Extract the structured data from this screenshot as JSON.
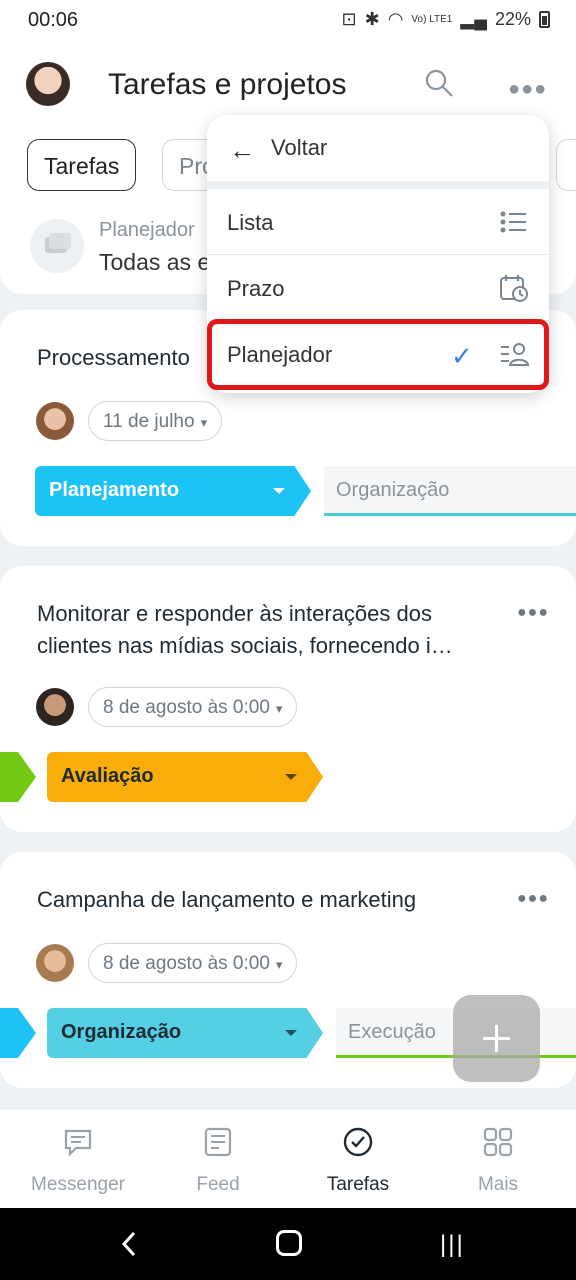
{
  "status_bar": {
    "time": "00:06",
    "network": "Vo) LTE1",
    "battery": "22%"
  },
  "header": {
    "title": "Tarefas e projetos",
    "tabs": [
      {
        "label": "Tarefas"
      },
      {
        "label": "Projetos"
      }
    ],
    "view_caption": "Planejador",
    "view_value": "Todas as etapas"
  },
  "menu": {
    "back_label": "Voltar",
    "items": [
      {
        "label": "Lista",
        "icon": "list-icon"
      },
      {
        "label": "Prazo",
        "icon": "calendar-clock-icon"
      },
      {
        "label": "Planejador",
        "icon": "planner-user-icon",
        "selected": true
      }
    ]
  },
  "cards": [
    {
      "title": "Processamento",
      "date": "11 de julho",
      "stage": "Planejamento",
      "stage_color": "#1ec3f5",
      "next_stage": "Organização",
      "next_stage_color": "#4dc9dc"
    },
    {
      "title": "Monitorar e responder às interações dos clientes nas mídias sociais, fornecendo i…",
      "date": "8 de agosto às 0:00",
      "stage": "Avaliação",
      "stage_color": "#f8ad08",
      "prev_stage_color": "#73c914"
    },
    {
      "title": "Campanha de lançamento e marketing",
      "date": "8 de agosto às 0:00",
      "stage": "Organização",
      "stage_color": "#55cfe3",
      "prev_stage_color": "#1ec3f5",
      "next_stage": "Execução",
      "next_stage_color": "#73c914"
    }
  ],
  "bottom_nav": [
    {
      "label": "Messenger",
      "icon": "chat-icon"
    },
    {
      "label": "Feed",
      "icon": "feed-icon"
    },
    {
      "label": "Tarefas",
      "icon": "check-circle-icon",
      "active": true
    },
    {
      "label": "Mais",
      "icon": "grid-icon"
    }
  ]
}
